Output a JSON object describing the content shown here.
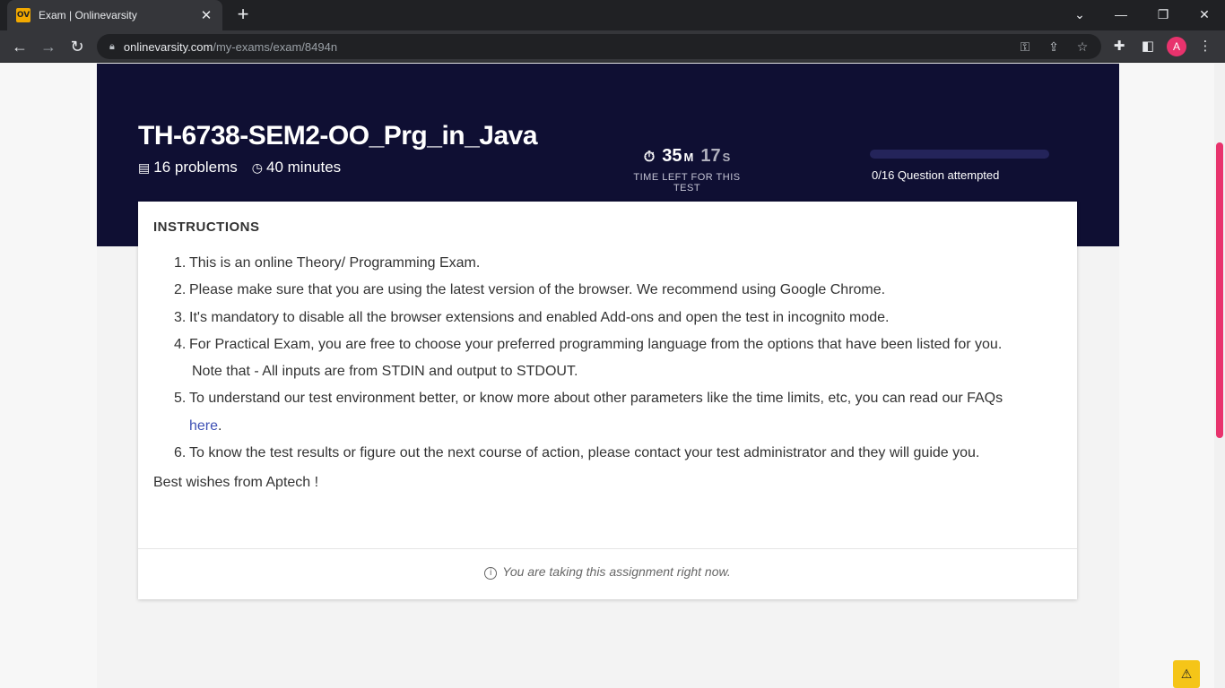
{
  "browser": {
    "tab_title": "Exam | Onlinevarsity",
    "favicon_text": "OV",
    "url_host": "onlinevarsity.com",
    "url_path": "/my-exams/exam/8494n",
    "profile_initial": "A"
  },
  "exam": {
    "title": "TH-6738-SEM2-OO_Prg_in_Java",
    "problems": "16 problems",
    "duration": "40 minutes"
  },
  "timer": {
    "minutes": "35",
    "minutes_unit": "M",
    "seconds": "17",
    "seconds_unit": "S",
    "label": "TIME LEFT FOR THIS TEST"
  },
  "progress": {
    "attempted": 0,
    "total": 16,
    "fraction": 0,
    "label": "0/16 Question attempted"
  },
  "instructions": {
    "heading": "INSTRUCTIONS",
    "items": [
      "This is an online Theory/ Programming Exam.",
      "Please make sure that you are using the latest version of the browser. We recommend using Google Chrome.",
      "It's mandatory to disable all the browser extensions and enabled Add-ons and open the test in incognito mode.",
      "For Practical Exam, you are free to choose your preferred programming language from the options that have been listed for you.",
      "To understand our test environment better, or know more about other parameters like the time limits, etc, you can read our FAQs",
      "To know the test results or figure out the next course of action, please contact your test administrator and they will guide you."
    ],
    "item4_continuation": "Note that - All inputs are from STDIN and output to STDOUT.",
    "faq_link": "here",
    "faq_link_suffix": ".",
    "closing": "Best wishes from Aptech !"
  },
  "footer": {
    "status": "You are taking this assignment right now."
  },
  "colors": {
    "header_bg": "#0f0f33",
    "link": "#3f51b5",
    "scroll_accent": "#e8336d",
    "warning": "#f5c518"
  },
  "icons": {
    "problems": "book-icon",
    "duration": "clock-icon",
    "timer": "stopwatch-icon",
    "footer": "info-icon",
    "warning": "warning-icon"
  }
}
